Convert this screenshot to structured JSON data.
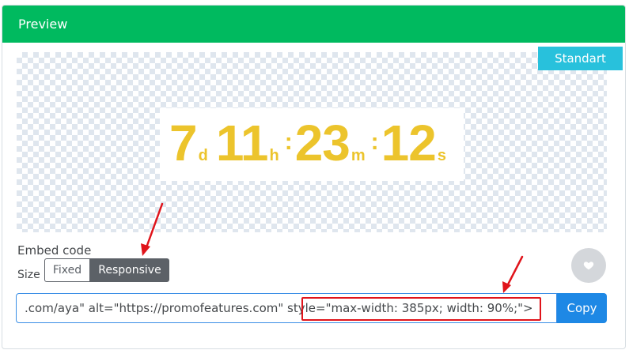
{
  "panel": {
    "title": "Preview"
  },
  "preview": {
    "badge": "Standart",
    "timer": {
      "days": "7",
      "days_unit": "d",
      "hours": "11",
      "hours_unit": "h",
      "minutes": "23",
      "minutes_unit": "m",
      "seconds": "12",
      "seconds_unit": "s",
      "separator": ":"
    }
  },
  "embed": {
    "label": "Embed code",
    "size_label": "Size",
    "size_options": [
      "Fixed",
      "Responsive"
    ],
    "selected_size": "Responsive",
    "code_value": ".com/aya\" alt=\"https://promofeatures.com\" style=\"max-width: 385px; width: 90%;\">",
    "copy_label": "Copy"
  },
  "colors": {
    "header": "#00ba5f",
    "badge": "#28c1dc",
    "timer_digits": "#ecc42c",
    "toggle_active": "#5c6167",
    "copy_button": "#1e88e5",
    "annotation": "#e0141b"
  },
  "icons": {
    "favorite": "heart-icon"
  }
}
